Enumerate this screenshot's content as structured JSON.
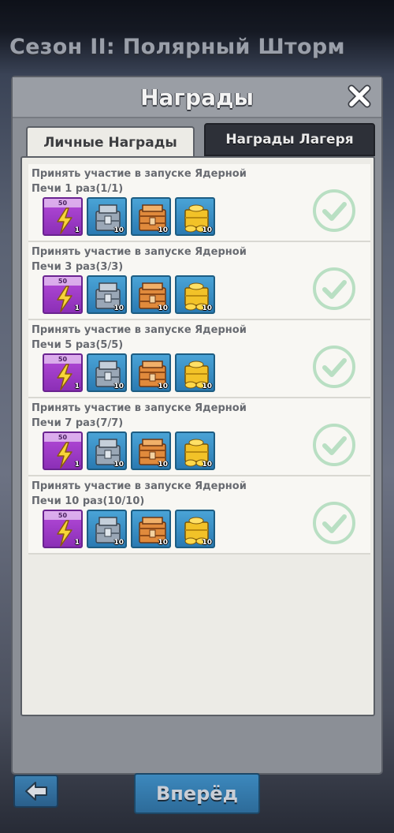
{
  "season_title": "Сезон II: Полярный Шторм",
  "modal": {
    "title": "Награды",
    "close_icon": "close-icon",
    "tabs": [
      {
        "label": "Личные Награды",
        "active": true
      },
      {
        "label": "Награды Лагеря",
        "active": false
      }
    ]
  },
  "rewards": [
    {
      "line1": "Принять участие в запуске Ядерной",
      "line2": "Печи 1 раз(1/1)",
      "items": [
        {
          "icon": "energy-bolt-icon",
          "top": "50",
          "count": "1"
        },
        {
          "icon": "steel-crate-icon",
          "count": "10"
        },
        {
          "icon": "wood-crate-icon",
          "count": "10"
        },
        {
          "icon": "gold-coins-icon",
          "count": "10"
        }
      ],
      "completed": true
    },
    {
      "line1": "Принять участие в запуске Ядерной",
      "line2": "Печи 3 раз(3/3)",
      "items": [
        {
          "icon": "energy-bolt-icon",
          "top": "50",
          "count": "1"
        },
        {
          "icon": "steel-crate-icon",
          "count": "10"
        },
        {
          "icon": "wood-crate-icon",
          "count": "10"
        },
        {
          "icon": "gold-coins-icon",
          "count": "10"
        }
      ],
      "completed": true
    },
    {
      "line1": "Принять участие в запуске Ядерной",
      "line2": "Печи 5 раз(5/5)",
      "items": [
        {
          "icon": "energy-bolt-icon",
          "top": "50",
          "count": "1"
        },
        {
          "icon": "steel-crate-icon",
          "count": "10"
        },
        {
          "icon": "wood-crate-icon",
          "count": "10"
        },
        {
          "icon": "gold-coins-icon",
          "count": "10"
        }
      ],
      "completed": true
    },
    {
      "line1": "Принять участие в запуске Ядерной",
      "line2": "Печи 7 раз(7/7)",
      "items": [
        {
          "icon": "energy-bolt-icon",
          "top": "50",
          "count": "1"
        },
        {
          "icon": "steel-crate-icon",
          "count": "10"
        },
        {
          "icon": "wood-crate-icon",
          "count": "10"
        },
        {
          "icon": "gold-coins-icon",
          "count": "10"
        }
      ],
      "completed": true
    },
    {
      "line1": "Принять участие в запуске Ядерной",
      "line2": "Печи 10 раз(10/10)",
      "items": [
        {
          "icon": "energy-bolt-icon",
          "top": "50",
          "count": "1"
        },
        {
          "icon": "steel-crate-icon",
          "count": "10"
        },
        {
          "icon": "wood-crate-icon",
          "count": "10"
        },
        {
          "icon": "gold-coins-icon",
          "count": "10"
        }
      ],
      "completed": true
    }
  ],
  "bottom": {
    "back_icon": "arrow-left-icon",
    "next_label": "Вперёд"
  },
  "colors": {
    "accent_blue": "#2a7ab2",
    "energy_purple": "#8b2fb6",
    "check_green": "#b9dfc3"
  }
}
